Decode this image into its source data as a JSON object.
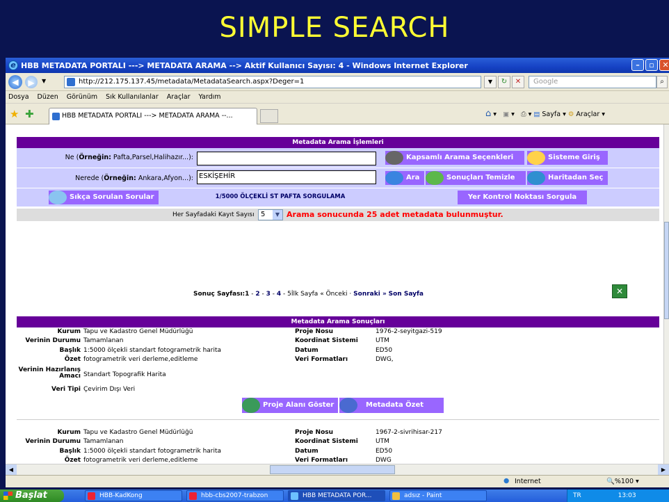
{
  "slide_title": "SIMPLE SEARCH",
  "window": {
    "title": "HBB METADATA PORTALI ---> METADATA ARAMA --> Aktif Kullanıcı Sayısı: 4 - Windows Internet Explorer",
    "address": "http://212.175.137.45/metadata/MetadataSearch.aspx?Deger=1",
    "search_placeholder": "Google",
    "menu": [
      "Dosya",
      "Düzen",
      "Görünüm",
      "Sık Kullanılanlar",
      "Araçlar",
      "Yardım"
    ],
    "tab_title": "HBB METADATA PORTALI ---> METADATA ARAMA --...",
    "cmd": {
      "page": "Sayfa",
      "tools": "Araçlar"
    }
  },
  "search": {
    "header": "Metadata Arama İşlemleri",
    "ne_label_prefix": "Ne (",
    "ne_label_bold": "Örneğin:",
    "ne_label_suffix": " Pafta,Parsel,Halihazır...):",
    "ne_value": "",
    "nerede_label_prefix": "Nerede (",
    "nerede_label_bold": "Örneğin:",
    "nerede_label_suffix": " Ankara,Afyon...):",
    "nerede_value": "ESKİŞEHİR",
    "btn_advanced": "Kapsamlı Arama Seçenkleri",
    "btn_login": "Sisteme Giriş",
    "btn_search": "Ara",
    "btn_clear": "Sonuçları Temizle",
    "btn_map": "Haritadan Seç",
    "btn_faq": "Sıkça Sorulan Sorular",
    "link_1_5000": "1/5000 ÖLÇEKLİ ST PAFTA SORGULAMA",
    "btn_gcp": "Yer Kontrol Noktası Sorgula",
    "per_page_label": "Her Sayfadaki Kayıt Sayısı",
    "per_page_value": "5",
    "result_msg": "Arama sonucunda 25 adet metadata bulunmuştur."
  },
  "pager": {
    "label": "Sonuç Sayfası:",
    "current": "1",
    "sep1": " - ",
    "p2": "2",
    "sep2": " - ",
    "p3": "3",
    "sep3": " - ",
    "p4": "4",
    "sep4": " - ",
    "p5": "5",
    "first": "İlk Sayfa",
    "prev": "« Önceki",
    "dot": " · ",
    "next": "Sonraki »",
    "last": "Son Sayfa"
  },
  "results": {
    "header": "Metadata Arama Sonuçları",
    "labels": {
      "kurum": "Kurum",
      "durum": "Verinin Durumu",
      "baslik": "Başlık",
      "ozet": "Özet",
      "amac1": "Verinin Hazırlanış",
      "amac2": "Amacı",
      "tip": "Veri Tipi",
      "proje": "Proje Nosu",
      "koord": "Koordinat Sistemi",
      "datum": "Datum",
      "format": "Veri Formatları"
    },
    "btn_area": "Proje Alanı Göster",
    "btn_summary": "Metadata Özet",
    "items": [
      {
        "kurum": "Tapu ve Kadastro Genel Müdürlüğü",
        "durum": "Tamamlanan",
        "baslik": "1:5000 ölçekli standart fotogrametrik harita",
        "ozet": "fotogrametrik veri derleme,editleme",
        "amac": "Standart Topografik Harita",
        "tip": "Çevirim Dışı Veri",
        "proje": "1976-2-seyitgazi-519",
        "koord": "UTM",
        "datum": "ED50",
        "format": "DWG,"
      },
      {
        "kurum": "Tapu ve Kadastro Genel Müdürlüğü",
        "durum": "Tamamlanan",
        "baslik": "1:5000 ölçekli standart fotogrametrik harita",
        "ozet": "fotogrametrik veri derleme,editleme",
        "proje": "1967-2-sivrihisar-217",
        "koord": "UTM",
        "datum": "ED50",
        "format": "DWG"
      }
    ]
  },
  "status": {
    "zone": "Internet",
    "zoom": "%100"
  },
  "taskbar": {
    "start": "Başlat",
    "tasks": [
      "HBB-KadKong",
      "hbb-cbs2007-trabzon",
      "HBB METADATA POR...",
      "adsız - Paint"
    ],
    "lang": "TR",
    "clock": "13:03"
  },
  "colors": {
    "slide_bg": "#0a1450",
    "slide_title": "#ffff33",
    "header_purple": "#660099",
    "row_lavender": "#ccccff",
    "button_purple": "#9966ff",
    "result_red": "#ff0000",
    "link_navy": "#000066"
  }
}
